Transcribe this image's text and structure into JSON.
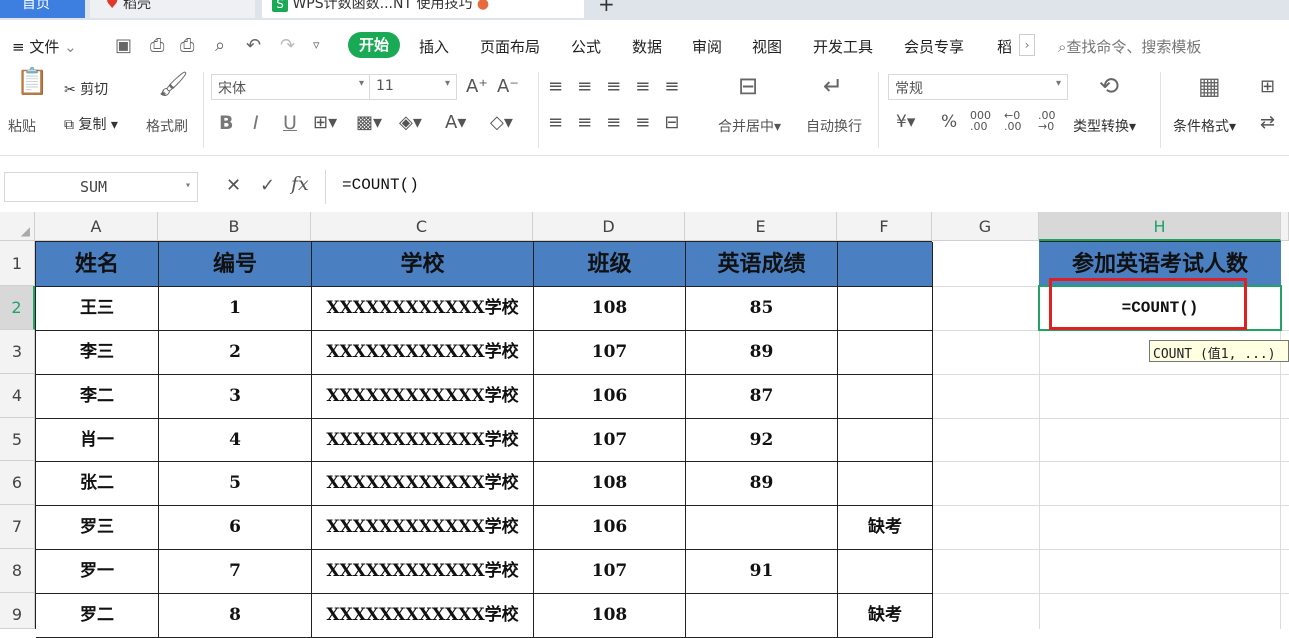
{
  "tabs": {
    "home": "首页",
    "docer": "稻壳",
    "doc": "WPS计数函数...NT   使用技巧",
    "add": "+"
  },
  "menu": {
    "file": "文件",
    "start": "开始",
    "items": [
      "插入",
      "页面布局",
      "公式",
      "数据",
      "审阅",
      "视图",
      "开发工具",
      "会员专享",
      "稻"
    ],
    "search": "查找命令、搜索模板"
  },
  "ribbon": {
    "paste": "粘贴",
    "cut": "剪切",
    "copy": "复制",
    "format_painter": "格式刷",
    "font": "宋体",
    "size": "11",
    "merge": "合并居中",
    "wrap": "自动换行",
    "number_format": "常规",
    "convert": "类型转换",
    "cond_format": "条件格式"
  },
  "formula_bar": {
    "name_box": "SUM",
    "fx": "fx",
    "formula": "=COUNT()"
  },
  "columns": [
    "A",
    "B",
    "C",
    "D",
    "E",
    "F",
    "G",
    "H"
  ],
  "rows": [
    "1",
    "2",
    "3",
    "4",
    "5",
    "6",
    "7",
    "8",
    "9"
  ],
  "table": {
    "headers": [
      "姓名",
      "编号",
      "学校",
      "班级",
      "英语成绩",
      ""
    ],
    "data": [
      [
        "王三",
        "1",
        "XXXXXXXXXXXX学校",
        "108",
        "85",
        ""
      ],
      [
        "李三",
        "2",
        "XXXXXXXXXXXX学校",
        "107",
        "89",
        ""
      ],
      [
        "李二",
        "3",
        "XXXXXXXXXXXX学校",
        "106",
        "87",
        ""
      ],
      [
        "肖一",
        "4",
        "XXXXXXXXXXXX学校",
        "107",
        "92",
        ""
      ],
      [
        "张二",
        "5",
        "XXXXXXXXXXXX学校",
        "108",
        "89",
        ""
      ],
      [
        "罗三",
        "6",
        "XXXXXXXXXXXX学校",
        "106",
        "",
        "缺考"
      ],
      [
        "罗一",
        "7",
        "XXXXXXXXXXXX学校",
        "107",
        "91",
        ""
      ],
      [
        "罗二",
        "8",
        "XXXXXXXXXXXX学校",
        "108",
        "",
        "缺考"
      ]
    ]
  },
  "h_header": "参加英语考试人数",
  "h_formula": "=COUNT()",
  "tooltip": "COUNT (值1, ...)",
  "colors": {
    "header_fill": "#4a7fc1",
    "active_border": "#21a366",
    "highlight": "#e02020",
    "accent": "#1aaa55"
  }
}
